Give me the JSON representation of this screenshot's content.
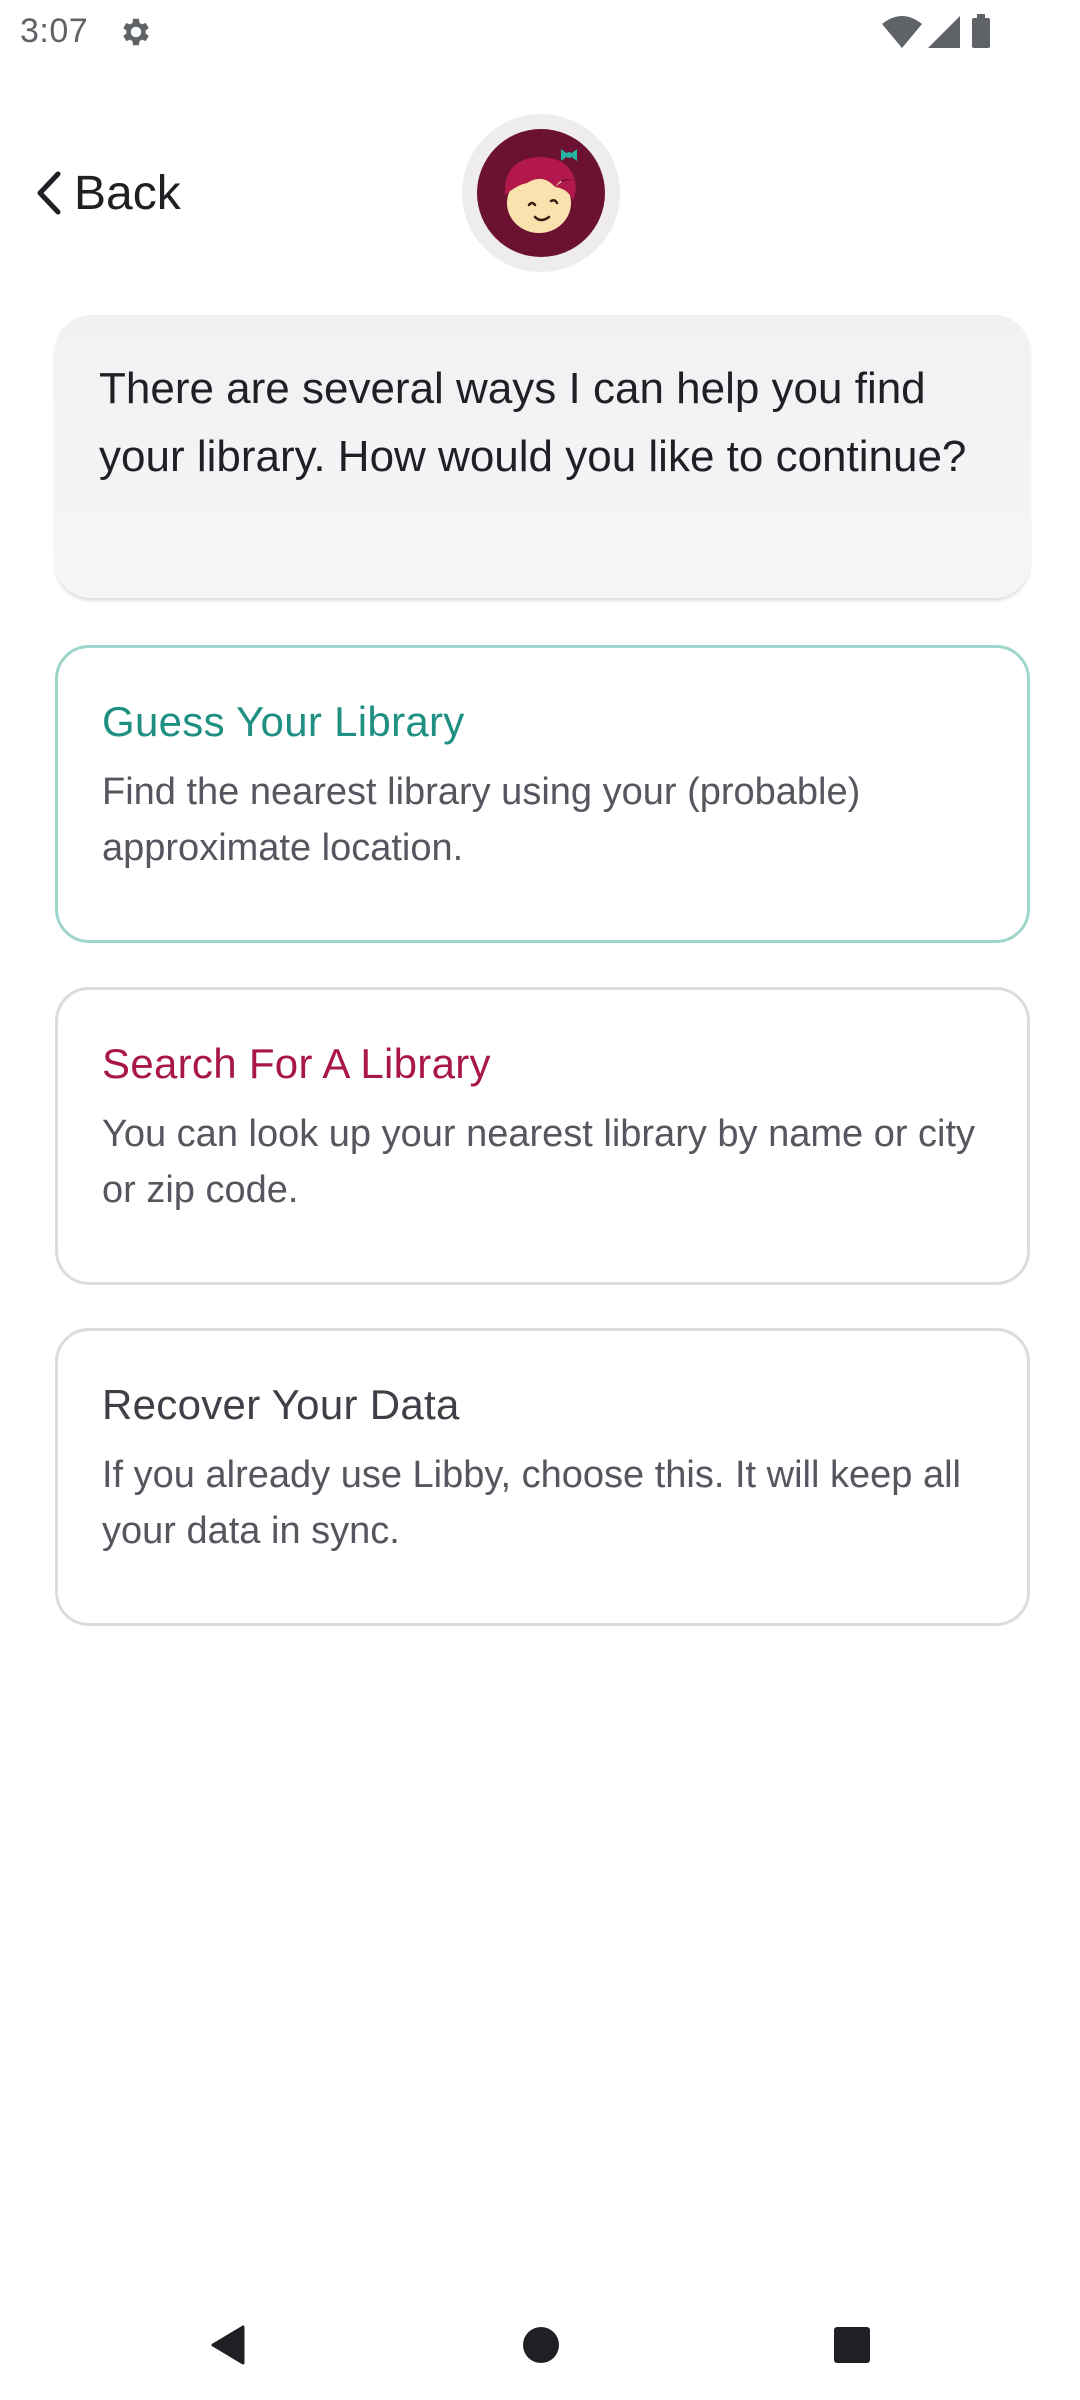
{
  "status_bar": {
    "time": "3:07",
    "left_icons": [
      "gear-icon"
    ],
    "right_icons": [
      "wifi-icon",
      "cell-signal-icon",
      "battery-icon"
    ]
  },
  "header": {
    "back_label": "Back",
    "back_icon": "chevron-left-icon",
    "avatar": "libby-logo-icon"
  },
  "message": {
    "text": "There are several ways I can help you find your library. How would you like to continue?"
  },
  "options": [
    {
      "title": "Guess Your Library",
      "description": "Find the nearest library using your (probable) approximate location.",
      "title_color": "#1f8f82"
    },
    {
      "title": "Search For A Library",
      "description": "You can look up your nearest library by name or city or zip code.",
      "title_color": "#a9164a"
    },
    {
      "title": "Recover Your Data",
      "description": "If you already use Libby, choose this. It will keep all your data in sync.",
      "title_color": "#3e3f47"
    }
  ],
  "nav_bar": {
    "buttons": [
      "nav-back-icon",
      "nav-home-icon",
      "nav-recents-icon"
    ]
  },
  "colors": {
    "brand_maroon": "#6b1233",
    "accent_teal": "#1f8f82",
    "accent_crimson": "#a9164a"
  }
}
